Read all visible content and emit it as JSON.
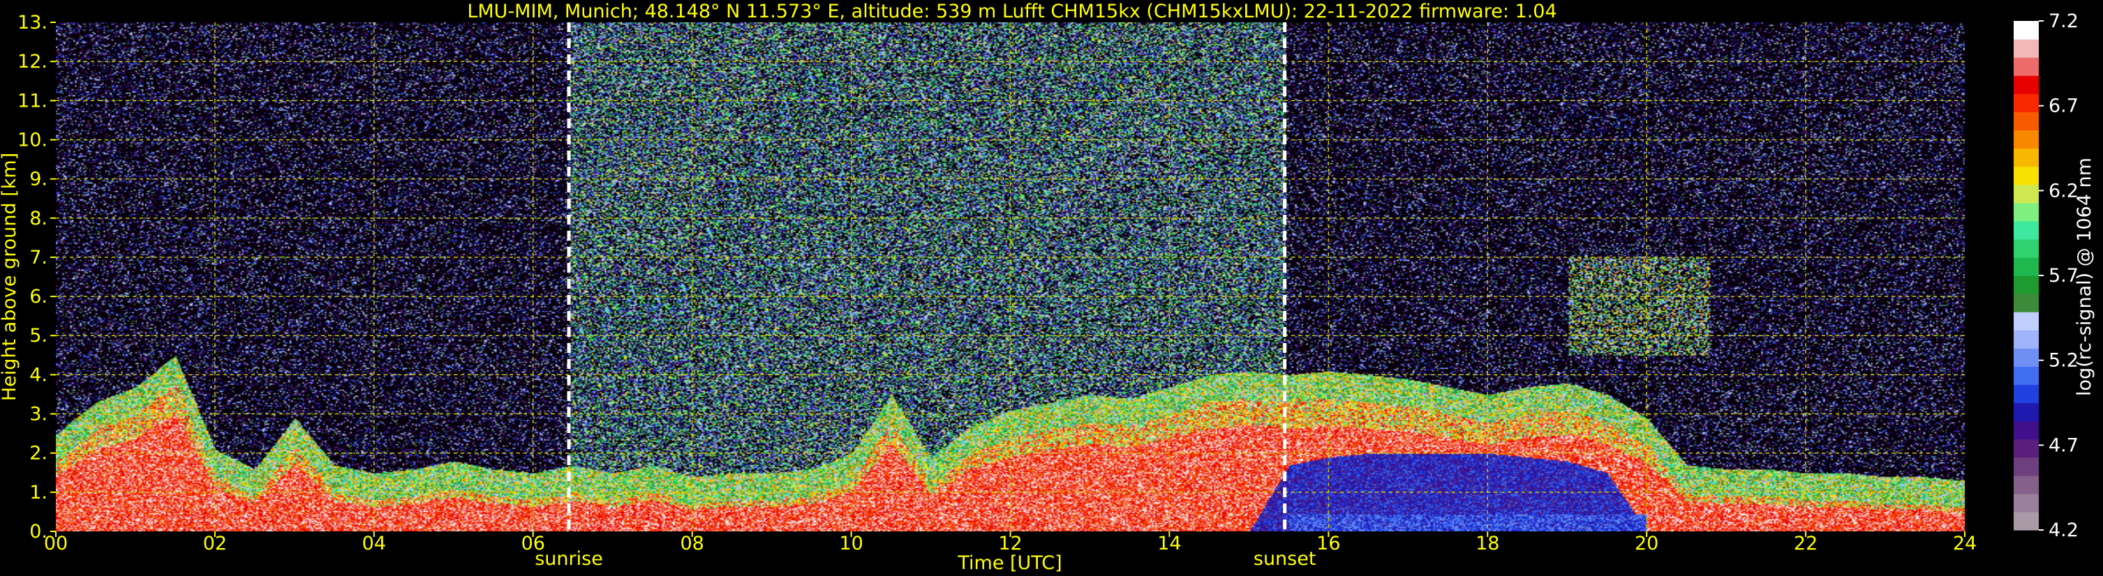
{
  "chart_data": {
    "type": "heatmap",
    "title": "LMU-MIM, Munich; 48.148° N 11.573° E, altitude: 539 m    Lufft CHM15kx (CHM15kxLMU): 22-11-2022    firmware: 1.04",
    "xlabel": "Time [UTC]",
    "ylabel": "Height above ground [km]",
    "xlim": [
      0,
      24
    ],
    "ylim": [
      0,
      13
    ],
    "x_ticks": [
      "00",
      "02",
      "04",
      "06",
      "08",
      "10",
      "12",
      "14",
      "16",
      "18",
      "20",
      "22",
      "24"
    ],
    "y_ticks": [
      "0.",
      "1.",
      "2.",
      "3.",
      "4.",
      "5.",
      "6.",
      "7.",
      "8.",
      "9.",
      "10.",
      "11.",
      "12.",
      "13."
    ],
    "grid": true,
    "markers": [
      {
        "label": "sunrise",
        "time": 6.45
      },
      {
        "label": "sunset",
        "time": 15.45
      }
    ],
    "colorbar": {
      "label": "log(rc-signal) @ 1064 nm",
      "range": [
        4.2,
        7.2
      ],
      "ticks": [
        "4.2",
        "4.7",
        "5.2",
        "5.7",
        "6.2",
        "6.7",
        "7.2"
      ]
    },
    "layers": [
      {
        "kind": "aerosol_boundary_layer",
        "top_km": [
          1.8,
          2.6,
          3.0,
          3.8,
          1.4,
          0.9,
          2.2,
          1.0,
          0.8,
          0.9,
          1.1,
          0.9,
          0.8,
          1.0,
          0.8,
          1.0,
          0.7,
          0.8,
          0.8,
          0.9,
          1.3,
          2.8,
          1.2,
          2.0,
          2.4,
          2.6,
          2.8,
          2.7,
          3.0,
          3.3,
          3.4,
          3.3,
          3.4,
          3.3,
          3.2,
          3.0,
          2.8,
          3.0,
          3.1,
          2.8,
          2.2,
          1.0,
          0.9,
          0.9,
          0.8,
          0.8,
          0.7,
          0.7,
          0.6
        ]
      },
      {
        "kind": "residual_layer",
        "top_km": [
          0,
          0,
          0,
          0,
          0,
          0,
          0,
          0,
          0,
          0,
          0,
          0,
          0,
          0,
          0,
          0,
          0,
          0,
          0,
          0,
          0,
          0,
          0,
          0,
          0,
          0,
          0,
          0,
          0,
          0,
          0,
          1.7,
          1.9,
          2.0,
          2.0,
          2.0,
          2.0,
          1.9,
          1.8,
          1.5,
          0,
          0,
          0,
          0,
          0,
          0,
          0,
          0,
          0
        ]
      },
      {
        "kind": "cloud",
        "time": [
          19.0,
          20.8
        ],
        "height_km": [
          4.5,
          7.0
        ]
      }
    ]
  },
  "colors": {
    "background": "#000000",
    "text_axis": "#ffff00",
    "text_colorbar": "#ffffff",
    "grid": "#c8c800",
    "markers": "#ffffff",
    "colormap": [
      "#a99aa8",
      "#9a7f9a",
      "#85608a",
      "#6e3f7e",
      "#5a1f7c",
      "#3f0f8c",
      "#2019b0",
      "#2040e0",
      "#3f6ff0",
      "#6f8ff5",
      "#9fb4fb",
      "#c0cffe",
      "#3d8a3a",
      "#1f9a2f",
      "#1fb84f",
      "#2fd26f",
      "#3fe89f",
      "#7ff07f",
      "#cfe84f",
      "#f8e000",
      "#f8b800",
      "#f88800",
      "#f85a00",
      "#f82800",
      "#e80000",
      "#ee6b6b",
      "#f2b7b7",
      "#ffffff"
    ]
  }
}
